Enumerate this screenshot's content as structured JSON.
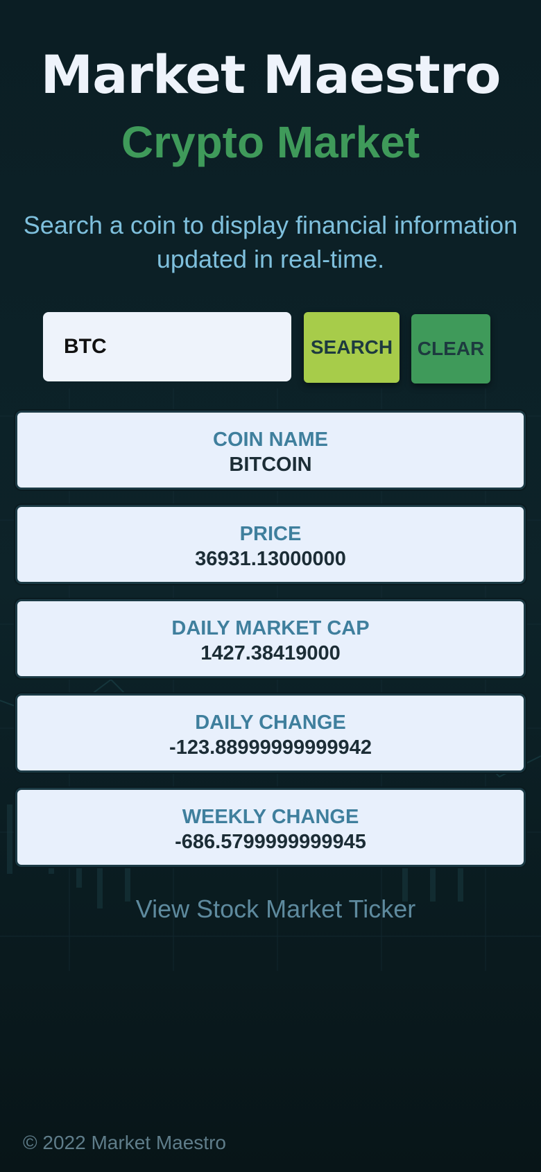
{
  "header": {
    "title": "Market Maestro",
    "subtitle": "Crypto Market"
  },
  "intro": "Search a coin to display financial information updated in real-time.",
  "search": {
    "value": "BTC",
    "search_label": "SEARCH",
    "clear_label": "CLEAR"
  },
  "cards": [
    {
      "label": "COIN NAME",
      "value": "BITCOIN"
    },
    {
      "label": "PRICE",
      "value": "36931.13000000"
    },
    {
      "label": "DAILY MARKET CAP",
      "value": "1427.38419000"
    },
    {
      "label": "DAILY CHANGE",
      "value": "-123.88999999999942"
    },
    {
      "label": "WEEKLY CHANGE",
      "value": "-686.5799999999945"
    }
  ],
  "link": "View Stock Market Ticker",
  "footer": "© 2022 Market Maestro",
  "colors": {
    "background": "#0c1f25",
    "title": "#eef3fb",
    "subtitle": "#3f9a5a",
    "intro": "#7fc0dd",
    "search_button": "#a7cc4a",
    "clear_button": "#3f9a5a",
    "card_background": "#e8f0fc",
    "card_label": "#3f7f9d"
  }
}
